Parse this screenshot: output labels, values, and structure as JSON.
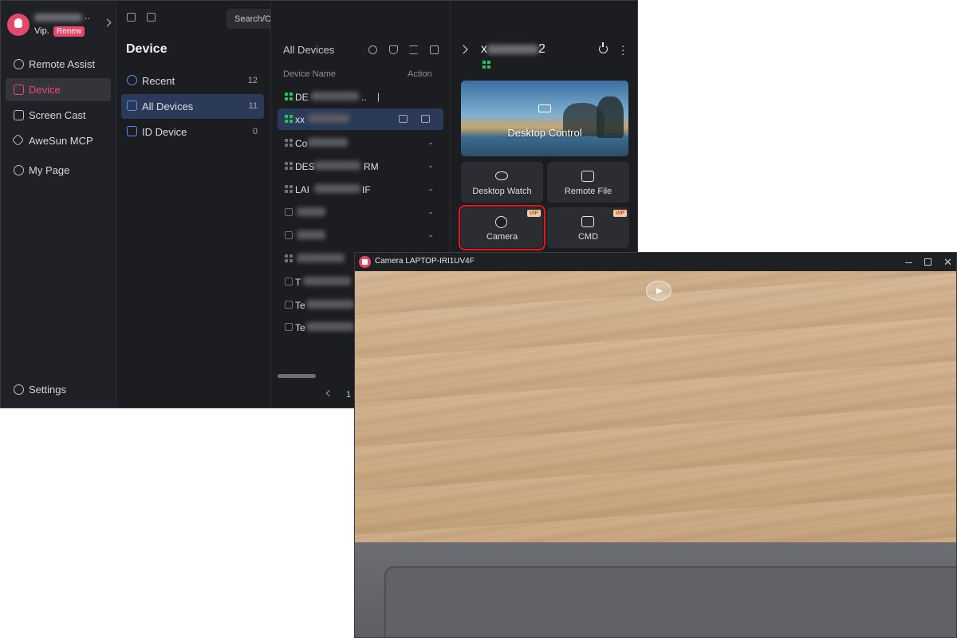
{
  "app": {
    "user": {
      "vip_label": "Vip.",
      "renew_label": "Renew"
    },
    "nav": [
      {
        "label": "Remote Assist"
      },
      {
        "label": "Device"
      },
      {
        "label": "Screen Cast"
      },
      {
        "label": "AweSun MCP"
      },
      {
        "label": "My Page"
      }
    ],
    "settings_label": "Settings",
    "search": {
      "placeholder": "Search/Connect Device"
    },
    "device_panel": {
      "title": "Device",
      "items": [
        {
          "label": "Recent",
          "count": "12"
        },
        {
          "label": "All Devices",
          "count": "11"
        },
        {
          "label": "ID Device",
          "count": "0"
        }
      ]
    },
    "list": {
      "title": "All Devices",
      "col_name": "Device Name",
      "col_action": "Action",
      "rows": [
        {
          "name": "DE",
          "tail": "..",
          "action": "|"
        },
        {
          "name": "xx",
          "tail": "",
          "action": ""
        },
        {
          "name": "Co",
          "tail": "",
          "action": "-"
        },
        {
          "name": "DES",
          "tail": "RM",
          "action": "-"
        },
        {
          "name": "LAI",
          "tail": "IF",
          "action": "-"
        },
        {
          "name": "",
          "tail": "",
          "action": "-"
        },
        {
          "name": "",
          "tail": "",
          "action": "-"
        },
        {
          "name": "",
          "tail": "",
          "action": ""
        },
        {
          "name": "T",
          "tail": "",
          "action": ""
        },
        {
          "name": "Te",
          "tail": "",
          "action": ""
        },
        {
          "name": "Te",
          "tail": "",
          "action": ""
        }
      ],
      "page": "1"
    },
    "detail": {
      "name_prefix": "x",
      "name_suffix": "2",
      "desktop_control": "Desktop Control",
      "desktop_watch": "Desktop Watch",
      "remote_file": "Remote File",
      "camera": "Camera",
      "cmd": "CMD",
      "vip_badge": "VIP"
    }
  },
  "camera_window": {
    "title": "Camera LAPTOP-IRI1UV4F"
  }
}
